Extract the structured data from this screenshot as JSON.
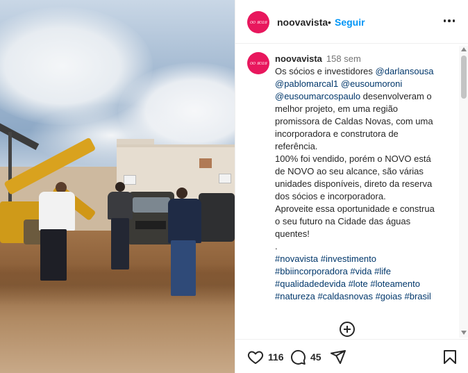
{
  "post": {
    "username": "noovavista",
    "follow_label": "Seguir",
    "separator": "•",
    "avatar_text": "oo ꞩcaꞩ",
    "time_ago": "158 sem",
    "caption_lines": [
      [
        {
          "t": "Os sócios e investidores "
        },
        {
          "t": "@darlansousa",
          "k": "mention"
        }
      ],
      [
        {
          "t": "@pablomarcal1",
          "k": "mention"
        },
        {
          "t": " "
        },
        {
          "t": "@eusoumoroni",
          "k": "mention"
        }
      ],
      [
        {
          "t": "@eusoumarcospaulo",
          "k": "mention"
        },
        {
          "t": " desenvolveram o"
        }
      ],
      [
        {
          "t": "melhor projeto, em uma região"
        }
      ],
      [
        {
          "t": "promissora de Caldas Novas, com uma"
        }
      ],
      [
        {
          "t": "incorporadora e construtora de"
        }
      ],
      [
        {
          "t": "referência."
        }
      ],
      [
        {
          "t": "100% foi vendido, porém o NOVO está"
        }
      ],
      [
        {
          "t": "de NOVO ao seu alcance, são várias"
        }
      ],
      [
        {
          "t": "unidades disponíveis, direto da reserva"
        }
      ],
      [
        {
          "t": "dos sócios e incorporadora."
        }
      ],
      [
        {
          "t": "Aproveite essa oportunidade e construa"
        }
      ],
      [
        {
          "t": "o seu futuro na Cidade das águas"
        }
      ],
      [
        {
          "t": "quentes!"
        }
      ],
      [
        {
          "t": "."
        }
      ],
      [
        {
          "t": "#novavista",
          "k": "tag"
        },
        {
          "t": " "
        },
        {
          "t": "#investimento",
          "k": "tag"
        }
      ],
      [
        {
          "t": "#bbiincorporadora",
          "k": "tag"
        },
        {
          "t": " "
        },
        {
          "t": "#vida",
          "k": "tag"
        },
        {
          "t": " "
        },
        {
          "t": "#life",
          "k": "tag"
        }
      ],
      [
        {
          "t": "#qualidadedevida",
          "k": "tag"
        },
        {
          "t": " "
        },
        {
          "t": "#lote",
          "k": "tag"
        },
        {
          "t": " "
        },
        {
          "t": "#loteamento",
          "k": "tag"
        }
      ],
      [
        {
          "t": "#natureza",
          "k": "tag"
        },
        {
          "t": " "
        },
        {
          "t": "#caldasnovas",
          "k": "tag"
        },
        {
          "t": " "
        },
        {
          "t": "#goias",
          "k": "tag"
        },
        {
          "t": " "
        },
        {
          "t": "#brasil",
          "k": "tag"
        }
      ]
    ]
  },
  "actions": {
    "likes": "116",
    "comments": "45"
  },
  "icons": {
    "like": "heart-icon",
    "comment": "comment-bubble-icon",
    "share": "paper-plane-icon",
    "save": "bookmark-icon",
    "more": "more-dots-icon",
    "add_comment": "plus-circle-icon"
  },
  "colors": {
    "link": "#0095f6",
    "mention": "#00376b",
    "avatar_bg": "#e8175d"
  }
}
